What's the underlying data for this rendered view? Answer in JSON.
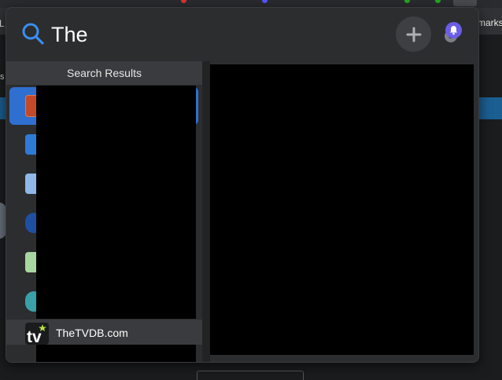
{
  "browser": {
    "bookmarks_left_fragment": "L",
    "bookmarks_right_fragment": "marks",
    "side_fragment": "s"
  },
  "search": {
    "query": "The"
  },
  "results": {
    "header": "Search Results",
    "visible_item": {
      "label": "TheTVDB.com",
      "icon": "tvdb-icon"
    },
    "icons": [
      "app-icon-tp",
      "app-icon-blue",
      "app-icon-lightblue",
      "app-icon-spiral",
      "app-icon-green",
      "app-icon-gear"
    ]
  },
  "colors": {
    "accent": "#2f6fd0",
    "notification": "#6b5ee6",
    "search_icon": "#3b8ef0"
  }
}
